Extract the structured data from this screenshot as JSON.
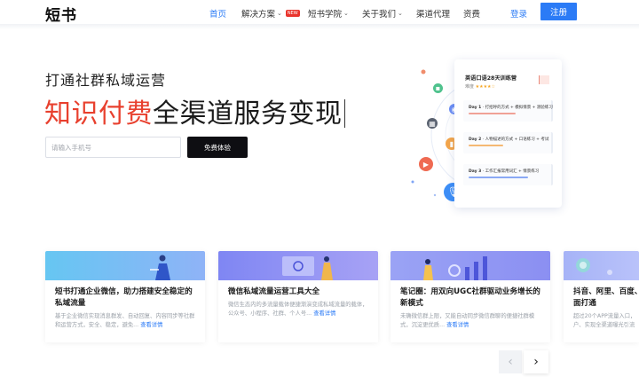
{
  "nav": {
    "logo": "短书",
    "items": [
      {
        "label": "首页",
        "active": true
      },
      {
        "label": "解决方案",
        "caret": true,
        "badge": "NEW"
      },
      {
        "label": "短书学院",
        "caret": true
      },
      {
        "label": "关于我们",
        "caret": true
      },
      {
        "label": "渠道代理"
      },
      {
        "label": "资费"
      }
    ],
    "login": "登录",
    "register": "注册"
  },
  "hero": {
    "subtitle": "打通社群私域运营",
    "title_red": "知识付费",
    "title_dark": "全渠道服务变现",
    "phone_placeholder": "请输入手机号",
    "cta": "免费体验"
  },
  "course_card": {
    "title": "英语口语28天训练营",
    "rating_label": "难度",
    "stars": "★★★★☆",
    "days": [
      {
        "day": "Day 1",
        "text": "· 打招呼的方式 + 模拟情景 + 测验练习",
        "progress": 0.62
      },
      {
        "day": "Day 2",
        "text": "· 人物描述的方式 + 口语练习 + 考试",
        "progress": 0.45
      },
      {
        "day": "Day 3",
        "text": "· 工作汇报常用词汇 + 情景练习",
        "progress": 0.78
      }
    ]
  },
  "cards": [
    {
      "title": "短书打通企业微信，助力搭建安全稳定的私域流量",
      "desc": "基于企业微信实现消息群发、自动回复、内容同步等社群和运营方式，安全、稳定，避免...",
      "more": "查看详情"
    },
    {
      "title": "微信私域流量运营工具大全",
      "desc": "微信生态内的多流量载体便捷渐演变成私域流量的载体，公众号、小程序、社群、个人号...",
      "more": "查看详情"
    },
    {
      "title": "笔记圈：用双向UGC社群驱动业务增长的新模式",
      "desc": "未确微信群上限，又能自动同步微信群聊的便捷社群模式，沉淀更优质...",
      "more": "查看详情"
    },
    {
      "title": "抖音、阿里、百度、面打通",
      "desc": "超过20个APP流量入口，户、实现全渠道曝光引流",
      "more": ""
    }
  ],
  "colors": {
    "accent": "#2b7bf6",
    "brand_red": "#e8402e",
    "cta_dark": "#0e0e12"
  }
}
